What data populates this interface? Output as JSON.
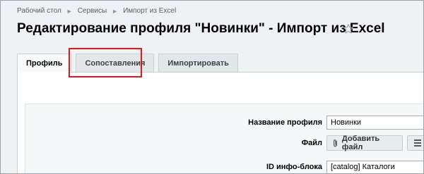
{
  "breadcrumb": {
    "items": [
      "Рабочий стол",
      "Сервисы",
      "Импорт из Excel"
    ]
  },
  "page": {
    "title": "Редактирование профиля \"Новинки\" - Импорт из Excel"
  },
  "tabs": [
    {
      "label": "Профиль",
      "active": true
    },
    {
      "label": "Сопоставления",
      "active": false,
      "highlighted": true
    },
    {
      "label": "Импортировать",
      "active": false
    }
  ],
  "form": {
    "profile_name_label": "Название профиля",
    "profile_name_value": "Новинки",
    "file_label": "Файл",
    "add_file_label": "Добавить файл",
    "iblock_label": "ID инфо-блока",
    "iblock_value": "[catalog] Каталоги"
  },
  "colors": {
    "highlight": "#e3181c",
    "background": "#eef2f4"
  },
  "icons": [
    "star-icon",
    "paperclip-icon",
    "menu-icon"
  ]
}
